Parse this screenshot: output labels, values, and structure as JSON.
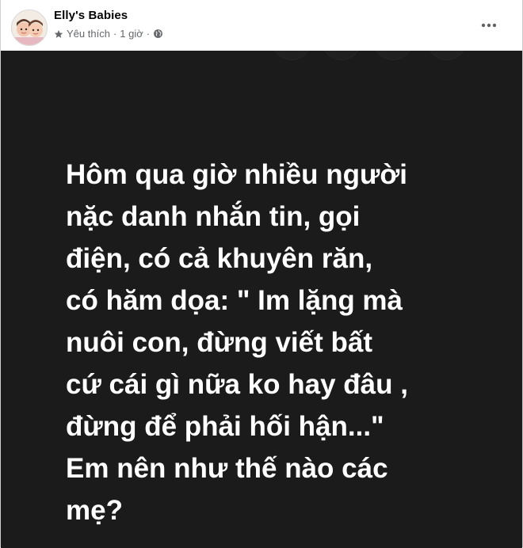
{
  "post": {
    "page_name": "Elly's Babies",
    "meta": {
      "status": "Yêu thích",
      "separator": "·",
      "time": "1 giờ",
      "separator2": "·"
    },
    "image_text_lines": [
      "Hôm qua giờ nhiều người",
      "nặc danh nhắn tin, gọi",
      "điện, có cả khuyên răn,",
      "có hăm dọa: \" Im lặng mà",
      "nuôi con, đừng viết bất",
      "cứ cái gì nữa ko hay đâu ,",
      "đừng để phải hối hận...\"",
      "Em nên như thế nào các",
      "mẹ?"
    ]
  },
  "icons": {
    "star": "star-icon",
    "globe": "globe-icon",
    "more": "more-icon"
  },
  "colors": {
    "image_background": "#1b1b1b",
    "image_text": "#ffffff",
    "name_text": "#050505",
    "meta_text": "#65676b"
  }
}
